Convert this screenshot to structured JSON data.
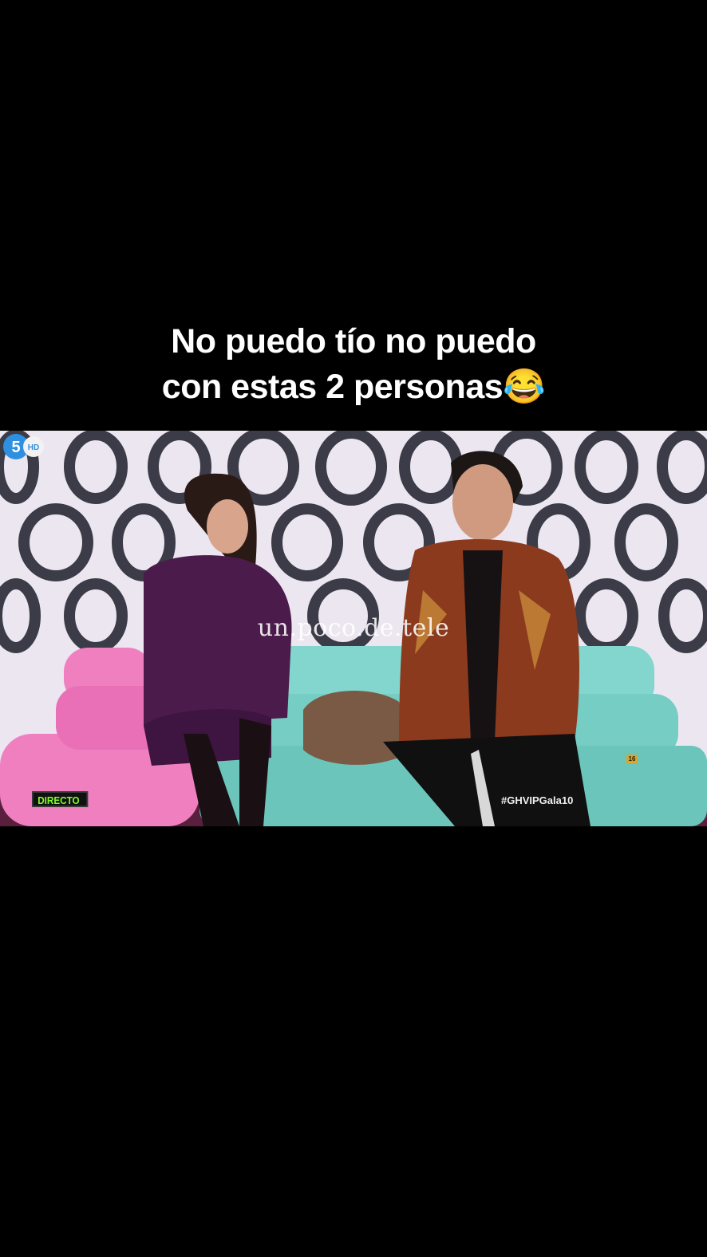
{
  "caption": {
    "line1": "No puedo tío no puedo",
    "line2": "con estas 2 personas😂"
  },
  "video": {
    "watermark": "un.poco.de.tele",
    "live_badge": "DIRECTO",
    "hashtag": "#GHVIPGala10",
    "rating": "16",
    "channel_icon": "telecinco-5-hd-logo-icon",
    "channel_hd": "HD"
  },
  "colors": {
    "background": "#000000",
    "caption_text": "#ffffff",
    "live_badge_text": "#7fff2a",
    "sofa_pink": "#f07fc0",
    "sofa_teal": "#7fd8cf",
    "wall": "#e9e2ee"
  }
}
